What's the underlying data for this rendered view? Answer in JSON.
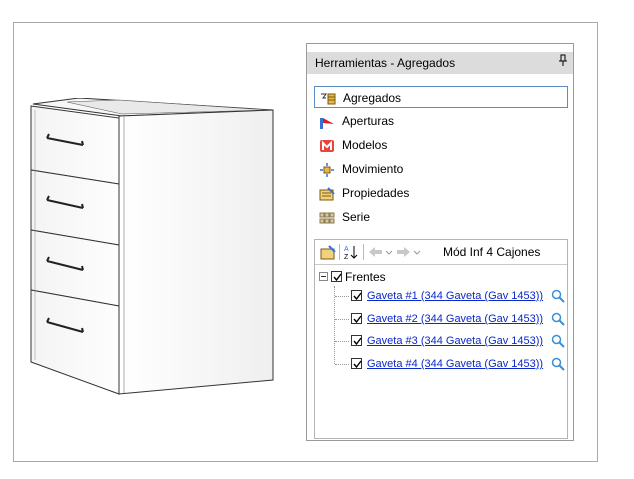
{
  "panel": {
    "title": "Herramientas - Agregados",
    "pin_glyph": "⸴"
  },
  "buttons": [
    {
      "label": "Agregados",
      "icon": "agregados-icon",
      "selected": true
    },
    {
      "label": "Aperturas",
      "icon": "aperturas-icon",
      "selected": false
    },
    {
      "label": "Modelos",
      "icon": "modelos-icon",
      "selected": false
    },
    {
      "label": "Movimiento",
      "icon": "movimiento-icon",
      "selected": false
    },
    {
      "label": "Propiedades",
      "icon": "propiedades-icon",
      "selected": false
    },
    {
      "label": "Serie",
      "icon": "serie-icon",
      "selected": false
    }
  ],
  "tree": {
    "toolbar_title": "Mód Inf 4 Cajones",
    "root": {
      "label": "Frentes",
      "checked": true,
      "expanded": true
    },
    "items": [
      {
        "label": "Gaveta #1 (344 Gaveta (Gav  1453))",
        "checked": true
      },
      {
        "label": "Gaveta #2 (344 Gaveta (Gav  1453))",
        "checked": true
      },
      {
        "label": "Gaveta #3 (344 Gaveta (Gav  1453))",
        "checked": true
      },
      {
        "label": "Gaveta #4 (344 Gaveta (Gav  1453))",
        "checked": true
      }
    ]
  },
  "colors": {
    "link": "#0b28c8",
    "selected_border": "#5b8cc4",
    "title_bar": "#dcdcdc"
  }
}
